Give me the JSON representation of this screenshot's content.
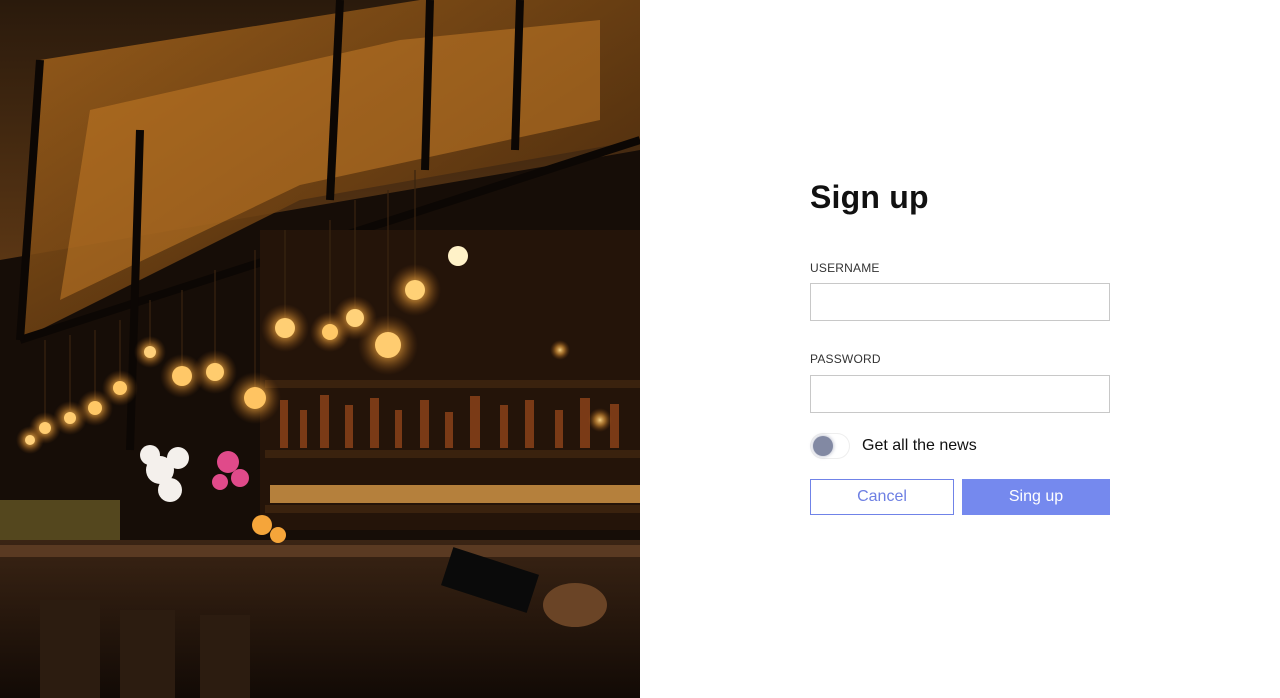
{
  "hero": {
    "image": "bar-interior-photo"
  },
  "form": {
    "title": "Sign up",
    "username": {
      "label": "USERNAME",
      "value": "",
      "placeholder": ""
    },
    "password": {
      "label": "PASSWORD",
      "value": "",
      "placeholder": ""
    },
    "newsletter": {
      "label": "Get all the news",
      "checked": false
    },
    "cancel_label": "Cancel",
    "submit_label": "Sing up"
  },
  "colors": {
    "accent": "#7589ee",
    "accent_text": "#6d7fe3",
    "toggle_knob": "#8289a3",
    "input_border": "#c8c8c8"
  }
}
